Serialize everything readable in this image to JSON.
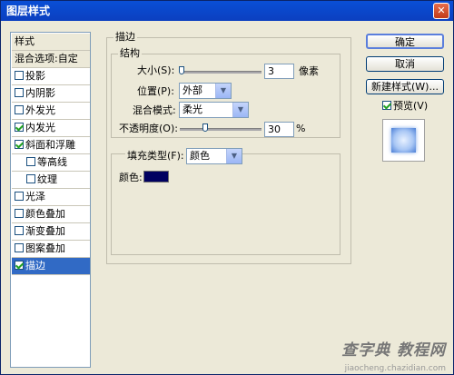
{
  "window": {
    "title": "图层样式",
    "close_glyph": "✕"
  },
  "sidebar": {
    "header": "样式",
    "blend_options": "混合选项:自定",
    "items": [
      {
        "label": "投影",
        "checked": false
      },
      {
        "label": "内阴影",
        "checked": false
      },
      {
        "label": "外发光",
        "checked": false
      },
      {
        "label": "内发光",
        "checked": true
      },
      {
        "label": "斜面和浮雕",
        "checked": true
      },
      {
        "label": "等高线",
        "checked": false,
        "sub": true
      },
      {
        "label": "纹理",
        "checked": false,
        "sub": true
      },
      {
        "label": "光泽",
        "checked": false
      },
      {
        "label": "颜色叠加",
        "checked": false
      },
      {
        "label": "渐变叠加",
        "checked": false
      },
      {
        "label": "图案叠加",
        "checked": false
      },
      {
        "label": "描边",
        "checked": true,
        "selected": true
      }
    ]
  },
  "stroke": {
    "title": "描边",
    "structure": {
      "title": "结构",
      "size_label": "大小(S):",
      "size_value": "3",
      "size_unit": "像素",
      "position_label": "位置(P):",
      "position_value": "外部",
      "blend_label": "混合模式:",
      "blend_value": "柔光",
      "opacity_label": "不透明度(O):",
      "opacity_value": "30",
      "opacity_unit": "%"
    },
    "fill": {
      "type_label": "填充类型(F):",
      "type_value": "颜色",
      "color_label": "颜色:",
      "color": "#000060"
    }
  },
  "buttons": {
    "ok": "确定",
    "cancel": "取消",
    "new_style": "新建样式(W)...",
    "preview_label": "预览(V)",
    "preview_checked": true
  },
  "watermark": {
    "logo": "查字典 教程网",
    "url": "jiaocheng.chazidian.com"
  },
  "icons": {
    "dropdown": "chevron-down-icon",
    "close": "close-icon",
    "check": "checkmark-icon"
  }
}
